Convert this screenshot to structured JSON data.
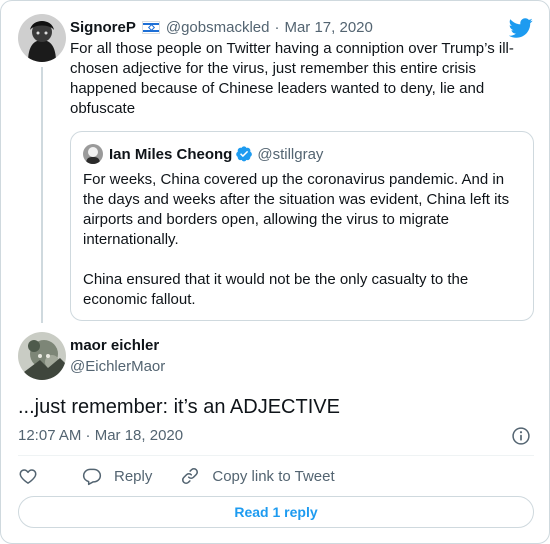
{
  "parent_tweet": {
    "display_name": "SignoreP",
    "flag_icon": "israel-flag-icon",
    "handle": "@gobsmackled",
    "separator": "·",
    "date": "Mar 17, 2020",
    "text": "For all those people on Twitter having a conniption over Trump’s ill-chosen adjective for the virus, just remember this entire crisis happened because of Chinese leaders wanted to deny, lie and obfuscate"
  },
  "quoted_tweet": {
    "display_name": "Ian Miles Cheong",
    "verified_icon": "verified-badge-icon",
    "handle": "@stillgray",
    "paragraph_1": "For weeks, China covered up the coronavirus pandemic. And in the days and weeks after the situation was evident, China left its airports and borders open, allowing the virus to migrate internationally.",
    "paragraph_2": "China ensured that it would not be the only casualty to the economic fallout."
  },
  "main_tweet": {
    "display_name": "maor eichler",
    "handle": "@EichlerMaor",
    "text": "...just remember: it’s an ADJECTIVE",
    "timestamp": "12:07 AM · Mar 18, 2020"
  },
  "actions": {
    "reply_label": "Reply",
    "copy_link_label": "Copy link to Tweet"
  },
  "read_replies_label": "Read 1 reply",
  "colors": {
    "accent": "#1d9bf0",
    "text": "#0f1419",
    "muted": "#536471",
    "border": "#cfd9de"
  }
}
